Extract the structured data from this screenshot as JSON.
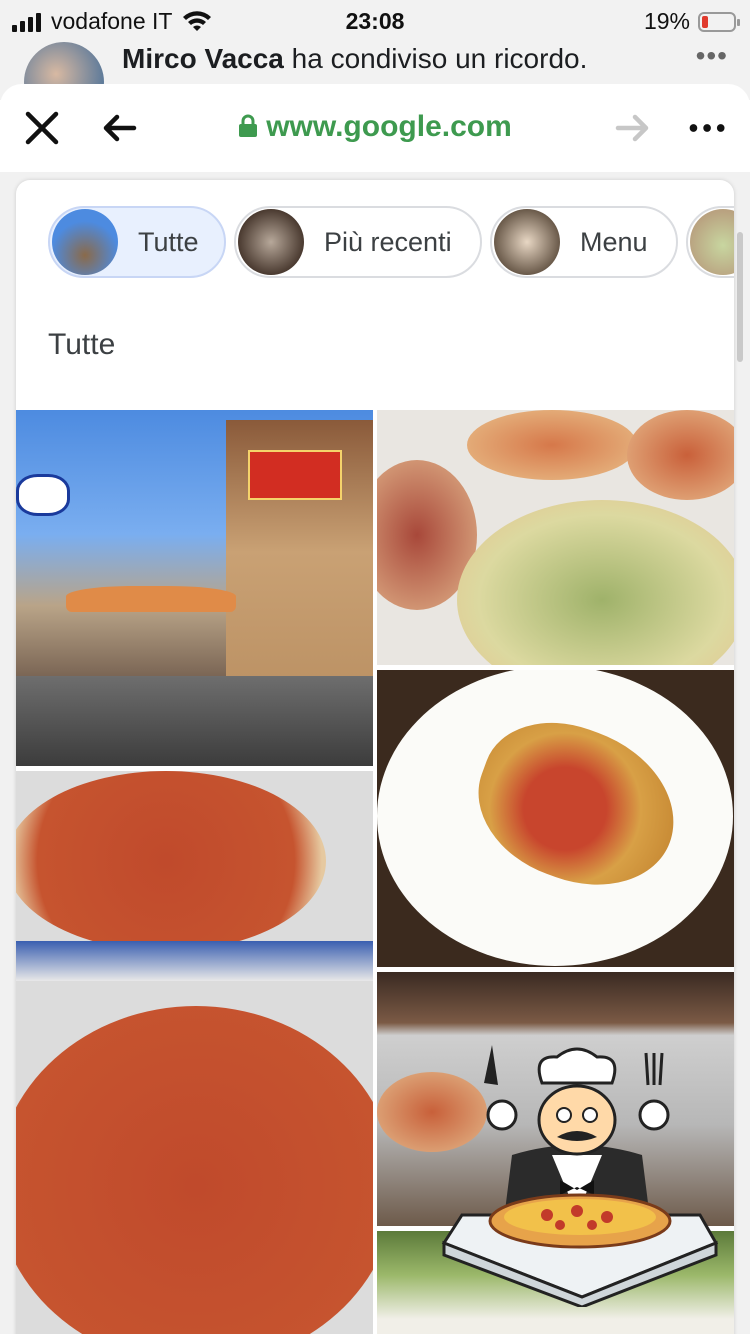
{
  "status_bar": {
    "carrier": "vodafone IT",
    "time": "23:08",
    "battery_percent": "19%",
    "battery_level": 0.19,
    "battery_color": "#e03a2d"
  },
  "feed_behind": {
    "author": "Mirco Vacca",
    "text": " ha condiviso un ricordo.",
    "more": "•••"
  },
  "browser": {
    "url": "www.google.com",
    "url_color": "#3e9a4f",
    "close_icon": "close-icon",
    "back_icon": "back-arrow-icon",
    "forward_icon": "forward-arrow-icon",
    "menu_icon": "more-icon"
  },
  "chips": [
    {
      "label": "Tutte",
      "active": true
    },
    {
      "label": "Più recenti",
      "active": false
    },
    {
      "label": "Menu",
      "active": false
    }
  ],
  "section_title": "Tutte",
  "photos": [
    {
      "name": "photo-storefront",
      "alt": "storefront"
    },
    {
      "name": "photo-pizzas-boxes",
      "alt": "pizzas"
    },
    {
      "name": "photo-cutlet-plate",
      "alt": "dish"
    },
    {
      "name": "photo-marinara-pizzas",
      "alt": "pizzas"
    },
    {
      "name": "photo-counter-pizza",
      "alt": "counter"
    },
    {
      "name": "photo-greens",
      "alt": "greens"
    }
  ],
  "sticker": {
    "icon": "chef-pizza-icon"
  }
}
